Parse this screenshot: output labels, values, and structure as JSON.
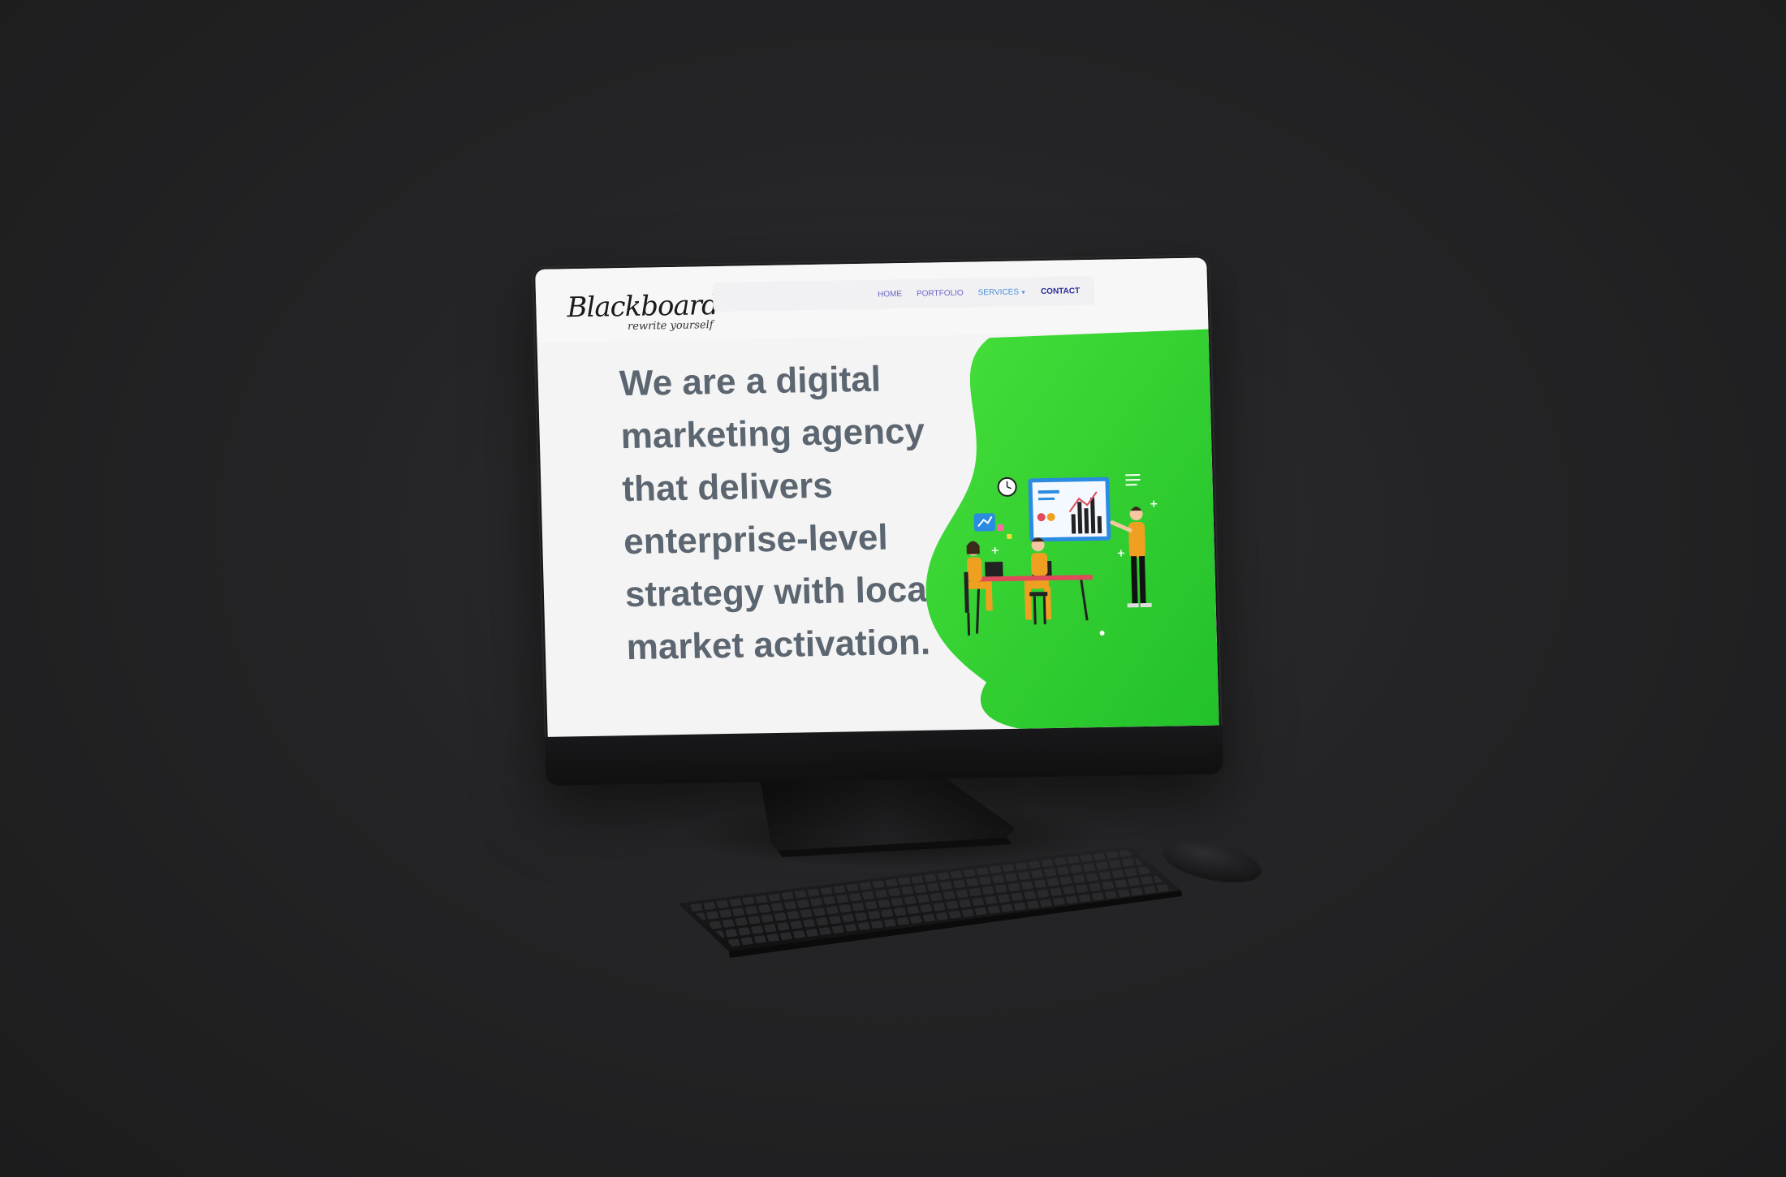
{
  "brand": {
    "name": "Blackboard",
    "tagline": "rewrite yourself"
  },
  "nav": {
    "items": [
      {
        "id": "home",
        "label": "HOME"
      },
      {
        "id": "portfolio",
        "label": "PORTFOLIO"
      },
      {
        "id": "services",
        "label": "SERVICES",
        "has_dropdown": true
      },
      {
        "id": "contact",
        "label": "CONTACT",
        "active": true
      }
    ]
  },
  "hero": {
    "lines": [
      "We are a digital",
      "marketing agency",
      "that delivers",
      "enterprise-level",
      "strategy with local",
      "market activation."
    ]
  },
  "colors": {
    "accent_green": "#3ad13a",
    "text_gray": "#5c6670",
    "person_orange": "#f0a020",
    "nav_link": "#6a64c8"
  },
  "icons": [
    "clock-icon",
    "chart-board-icon",
    "trend-chat-icon",
    "menu-lines-icon",
    "keyboard-icon",
    "mouse-icon"
  ]
}
